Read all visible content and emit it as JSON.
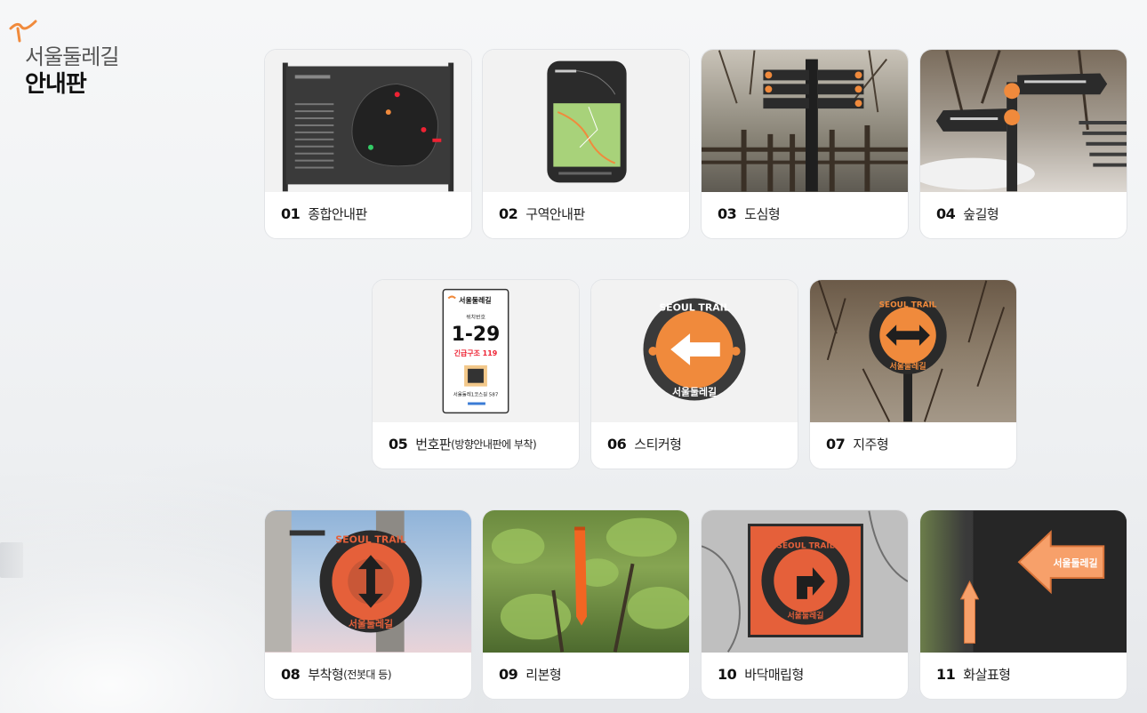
{
  "brand": {
    "subtitle": "서울둘레길",
    "title": "안내판"
  },
  "colors": {
    "accent": "#f08a3c",
    "sign_dark": "#2b2b2b",
    "card_bg": "#ffffff"
  },
  "items": [
    {
      "num": "01",
      "label": "종합안내판",
      "sub": ""
    },
    {
      "num": "02",
      "label": "구역안내판",
      "sub": ""
    },
    {
      "num": "03",
      "label": "도심형",
      "sub": ""
    },
    {
      "num": "04",
      "label": "숲길형",
      "sub": ""
    },
    {
      "num": "05",
      "label": "번호판",
      "sub": "(방향안내판에 부착)"
    },
    {
      "num": "06",
      "label": "스티커형",
      "sub": ""
    },
    {
      "num": "07",
      "label": "지주형",
      "sub": ""
    },
    {
      "num": "08",
      "label": "부착형",
      "sub": "(전봇대 등)"
    },
    {
      "num": "09",
      "label": "리본형",
      "sub": ""
    },
    {
      "num": "10",
      "label": "바닥매립형",
      "sub": ""
    },
    {
      "num": "11",
      "label": "화살표형",
      "sub": ""
    }
  ],
  "plate": {
    "brand": "서울둘레길",
    "caption": "위치번호",
    "number": "1-29",
    "emergency": "긴급구조 119",
    "address": "서울둘레1코스길 587"
  },
  "sticker": {
    "ring_top": "SEOUL TRAIL",
    "ring_bottom": "서울둘레길"
  },
  "arrow_sign": {
    "text": "서울둘레길"
  }
}
